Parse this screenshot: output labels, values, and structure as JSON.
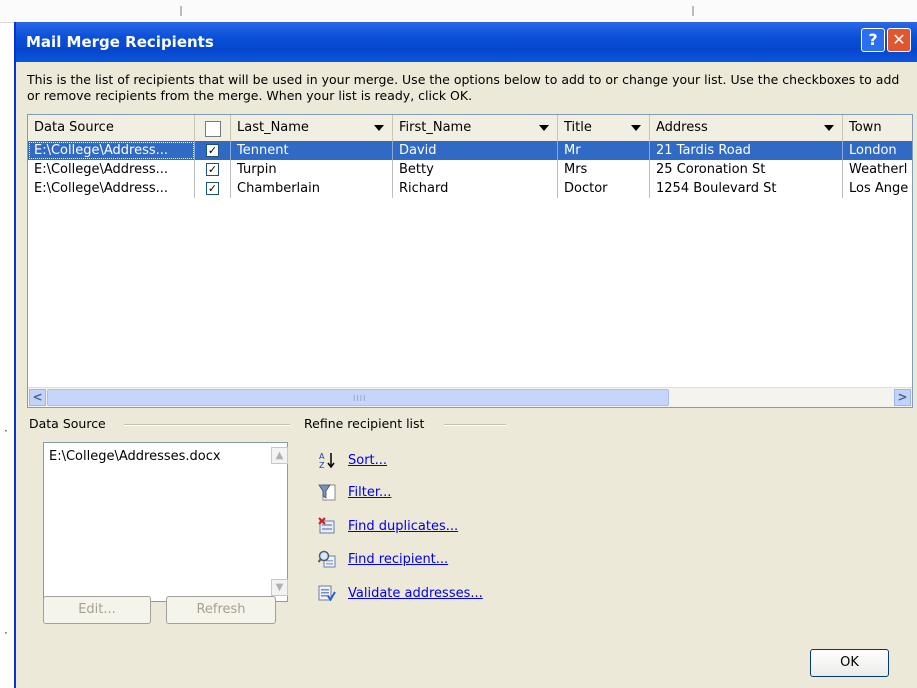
{
  "dialog": {
    "title": "Mail Merge Recipients",
    "help_glyph": "?",
    "close_glyph": "✕",
    "description": "This is the list of recipients that will be used in your merge.  Use the options below to add to or change your list.  Use the checkboxes to add or remove recipients from the merge.  When your list is ready, click OK."
  },
  "table": {
    "columns": [
      "Data Source",
      "",
      "Last_Name",
      "First_Name",
      "Title",
      "Address",
      "Town"
    ],
    "rows": [
      {
        "data_source": "E:\\College\\Address...",
        "checked": true,
        "last_name": "Tennent",
        "first_name": "David",
        "title": "Mr",
        "address": "21 Tardis Road",
        "town": "London",
        "selected": true
      },
      {
        "data_source": "E:\\College\\Address...",
        "checked": true,
        "last_name": "Turpin",
        "first_name": "Betty",
        "title": "Mrs",
        "address": "25 Coronation St",
        "town": "Weatherl",
        "selected": false
      },
      {
        "data_source": "E:\\College\\Address...",
        "checked": true,
        "last_name": "Chamberlain",
        "first_name": "Richard",
        "title": "Doctor",
        "address": "1254 Boulevard St",
        "town": "Los Ange",
        "selected": false
      }
    ],
    "scroll_left": "<",
    "scroll_right": ">",
    "scroll_grip": "IIII"
  },
  "data_source_group": {
    "label": "Data Source",
    "items": [
      "E:\\College\\Addresses.docx"
    ],
    "edit_label": "Edit...",
    "refresh_label": "Refresh"
  },
  "refine_group": {
    "label": "Refine recipient list",
    "links": [
      {
        "label": "Sort...",
        "icon": "sort-az-icon"
      },
      {
        "label": "Filter...",
        "icon": "filter-funnel-icon"
      },
      {
        "label": "Find duplicates...",
        "icon": "find-duplicates-icon"
      },
      {
        "label": "Find recipient...",
        "icon": "find-recipient-icon"
      },
      {
        "label": "Validate addresses...",
        "icon": "validate-addresses-icon"
      }
    ]
  },
  "ok_label": "OK",
  "colors": {
    "titlebar": "#0a4fd8",
    "selection": "#316ac5",
    "dialog_bg": "#ece9d8",
    "link": "#0000ee"
  }
}
